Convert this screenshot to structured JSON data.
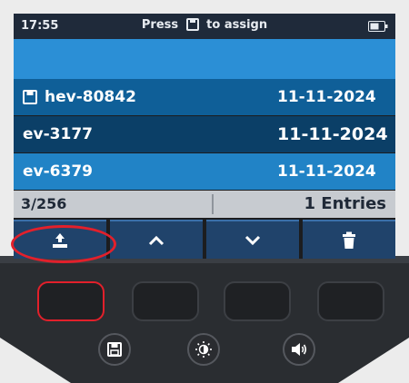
{
  "status": {
    "time": "17:55",
    "message_before": "Press",
    "message_icon": "save-icon",
    "message_after": "to assign",
    "battery_icon": "battery-icon"
  },
  "rows": [
    {
      "name": "hev-80842",
      "date": "11-11-2024",
      "icon": "save-icon"
    },
    {
      "name": "ev-3177",
      "date": "11-11-2024"
    },
    {
      "name": "ev-6379",
      "date": "11-11-2024"
    }
  ],
  "info": {
    "count": "3/256",
    "entries": "1 Entries"
  },
  "softkeys": [
    {
      "icon": "upload-icon"
    },
    {
      "icon": "chevron-up-icon"
    },
    {
      "icon": "chevron-down-icon"
    },
    {
      "icon": "trash-icon"
    }
  ],
  "hardware": {
    "function_keys": 4,
    "round_buttons": [
      {
        "icon": "save-icon"
      },
      {
        "icon": "brightness-icon"
      },
      {
        "icon": "volume-icon"
      }
    ]
  },
  "colors": {
    "header": "#1f2a3a",
    "accent": "#2b8fd6",
    "row_selected": "#0b3f67",
    "highlight": "#e2202b",
    "softkey": "#20436b"
  }
}
